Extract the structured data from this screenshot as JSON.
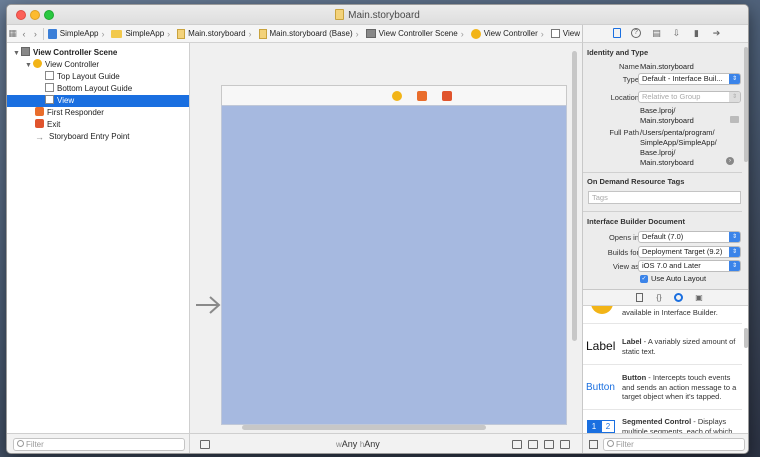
{
  "window": {
    "title": "Main.storyboard"
  },
  "jumpbar": {
    "crumbs": [
      {
        "label": "SimpleApp",
        "icon": "project-icon"
      },
      {
        "label": "SimpleApp",
        "icon": "folder-icon"
      },
      {
        "label": "Main.storyboard",
        "icon": "storyboard-icon"
      },
      {
        "label": "Main.storyboard (Base)",
        "icon": "storyboard-icon"
      },
      {
        "label": "View Controller Scene",
        "icon": "scene-icon"
      },
      {
        "label": "View Controller",
        "icon": "view-controller-icon"
      },
      {
        "label": "View",
        "icon": "view-icon"
      }
    ]
  },
  "outline": {
    "items": [
      {
        "label": "View Controller Scene",
        "indent": 0,
        "icon": "scene-icon",
        "expanded": true,
        "bold": true
      },
      {
        "label": "View Controller",
        "indent": 1,
        "icon": "view-controller-icon",
        "expanded": true
      },
      {
        "label": "Top Layout Guide",
        "indent": 2,
        "icon": "layout-guide-icon"
      },
      {
        "label": "Bottom Layout Guide",
        "indent": 2,
        "icon": "layout-guide-icon"
      },
      {
        "label": "View",
        "indent": 2,
        "icon": "view-icon",
        "selected": true
      },
      {
        "label": "First Responder",
        "indent": 1,
        "icon": "first-responder-icon"
      },
      {
        "label": "Exit",
        "indent": 1,
        "icon": "exit-icon"
      },
      {
        "label": "Storyboard Entry Point",
        "indent": 1,
        "icon": "entry-point-icon"
      }
    ],
    "filter_placeholder": "Filter"
  },
  "canvas": {
    "size_class": {
      "w_prefix": "w",
      "w_value": "Any",
      "h_prefix": "h",
      "h_value": "Any"
    },
    "view_color": "#a6b9e0"
  },
  "inspector": {
    "identity": {
      "heading": "Identity and Type",
      "name_label": "Name",
      "name_value": "Main.storyboard",
      "type_label": "Type",
      "type_value": "Default - Interface Buil...",
      "location_label": "Location",
      "location_value": "Relative to Group",
      "location_path_1": "Base.lproj/",
      "location_path_2": "Main.storyboard",
      "fullpath_label": "Full Path",
      "fullpath_1": "/Users/penta/program/",
      "fullpath_2": "SimpleApp/SimpleApp/",
      "fullpath_3": "Base.lproj/",
      "fullpath_4": "Main.storyboard"
    },
    "tags": {
      "heading": "On Demand Resource Tags",
      "placeholder": "Tags"
    },
    "ib_doc": {
      "heading": "Interface Builder Document",
      "opens_in_label": "Opens in",
      "opens_in_value": "Default (7.0)",
      "builds_for_label": "Builds for",
      "builds_for_value": "Deployment Target (9.2)",
      "view_as_label": "View as",
      "view_as_value": "iOS 7.0 and Later",
      "auto_layout_label": "Use Auto Layout",
      "auto_layout_checked": true
    }
  },
  "library": {
    "partial_text": "available in Interface Builder.",
    "items": [
      {
        "icon_text": "Label",
        "title": "Label",
        "desc": " - A variably sized amount of static text."
      },
      {
        "icon_text": "Button",
        "title": "Button",
        "desc": " - Intercepts touch events and sends an action message to a target object when it's tapped."
      },
      {
        "icon_text_1": "1",
        "icon_text_2": "2",
        "title": "Segmented Control",
        "desc": " - Displays multiple segments, each of which"
      }
    ],
    "filter_placeholder": "Filter"
  },
  "colors": {
    "accent": "#1a6fe0",
    "selection": "#1a6fe0"
  }
}
